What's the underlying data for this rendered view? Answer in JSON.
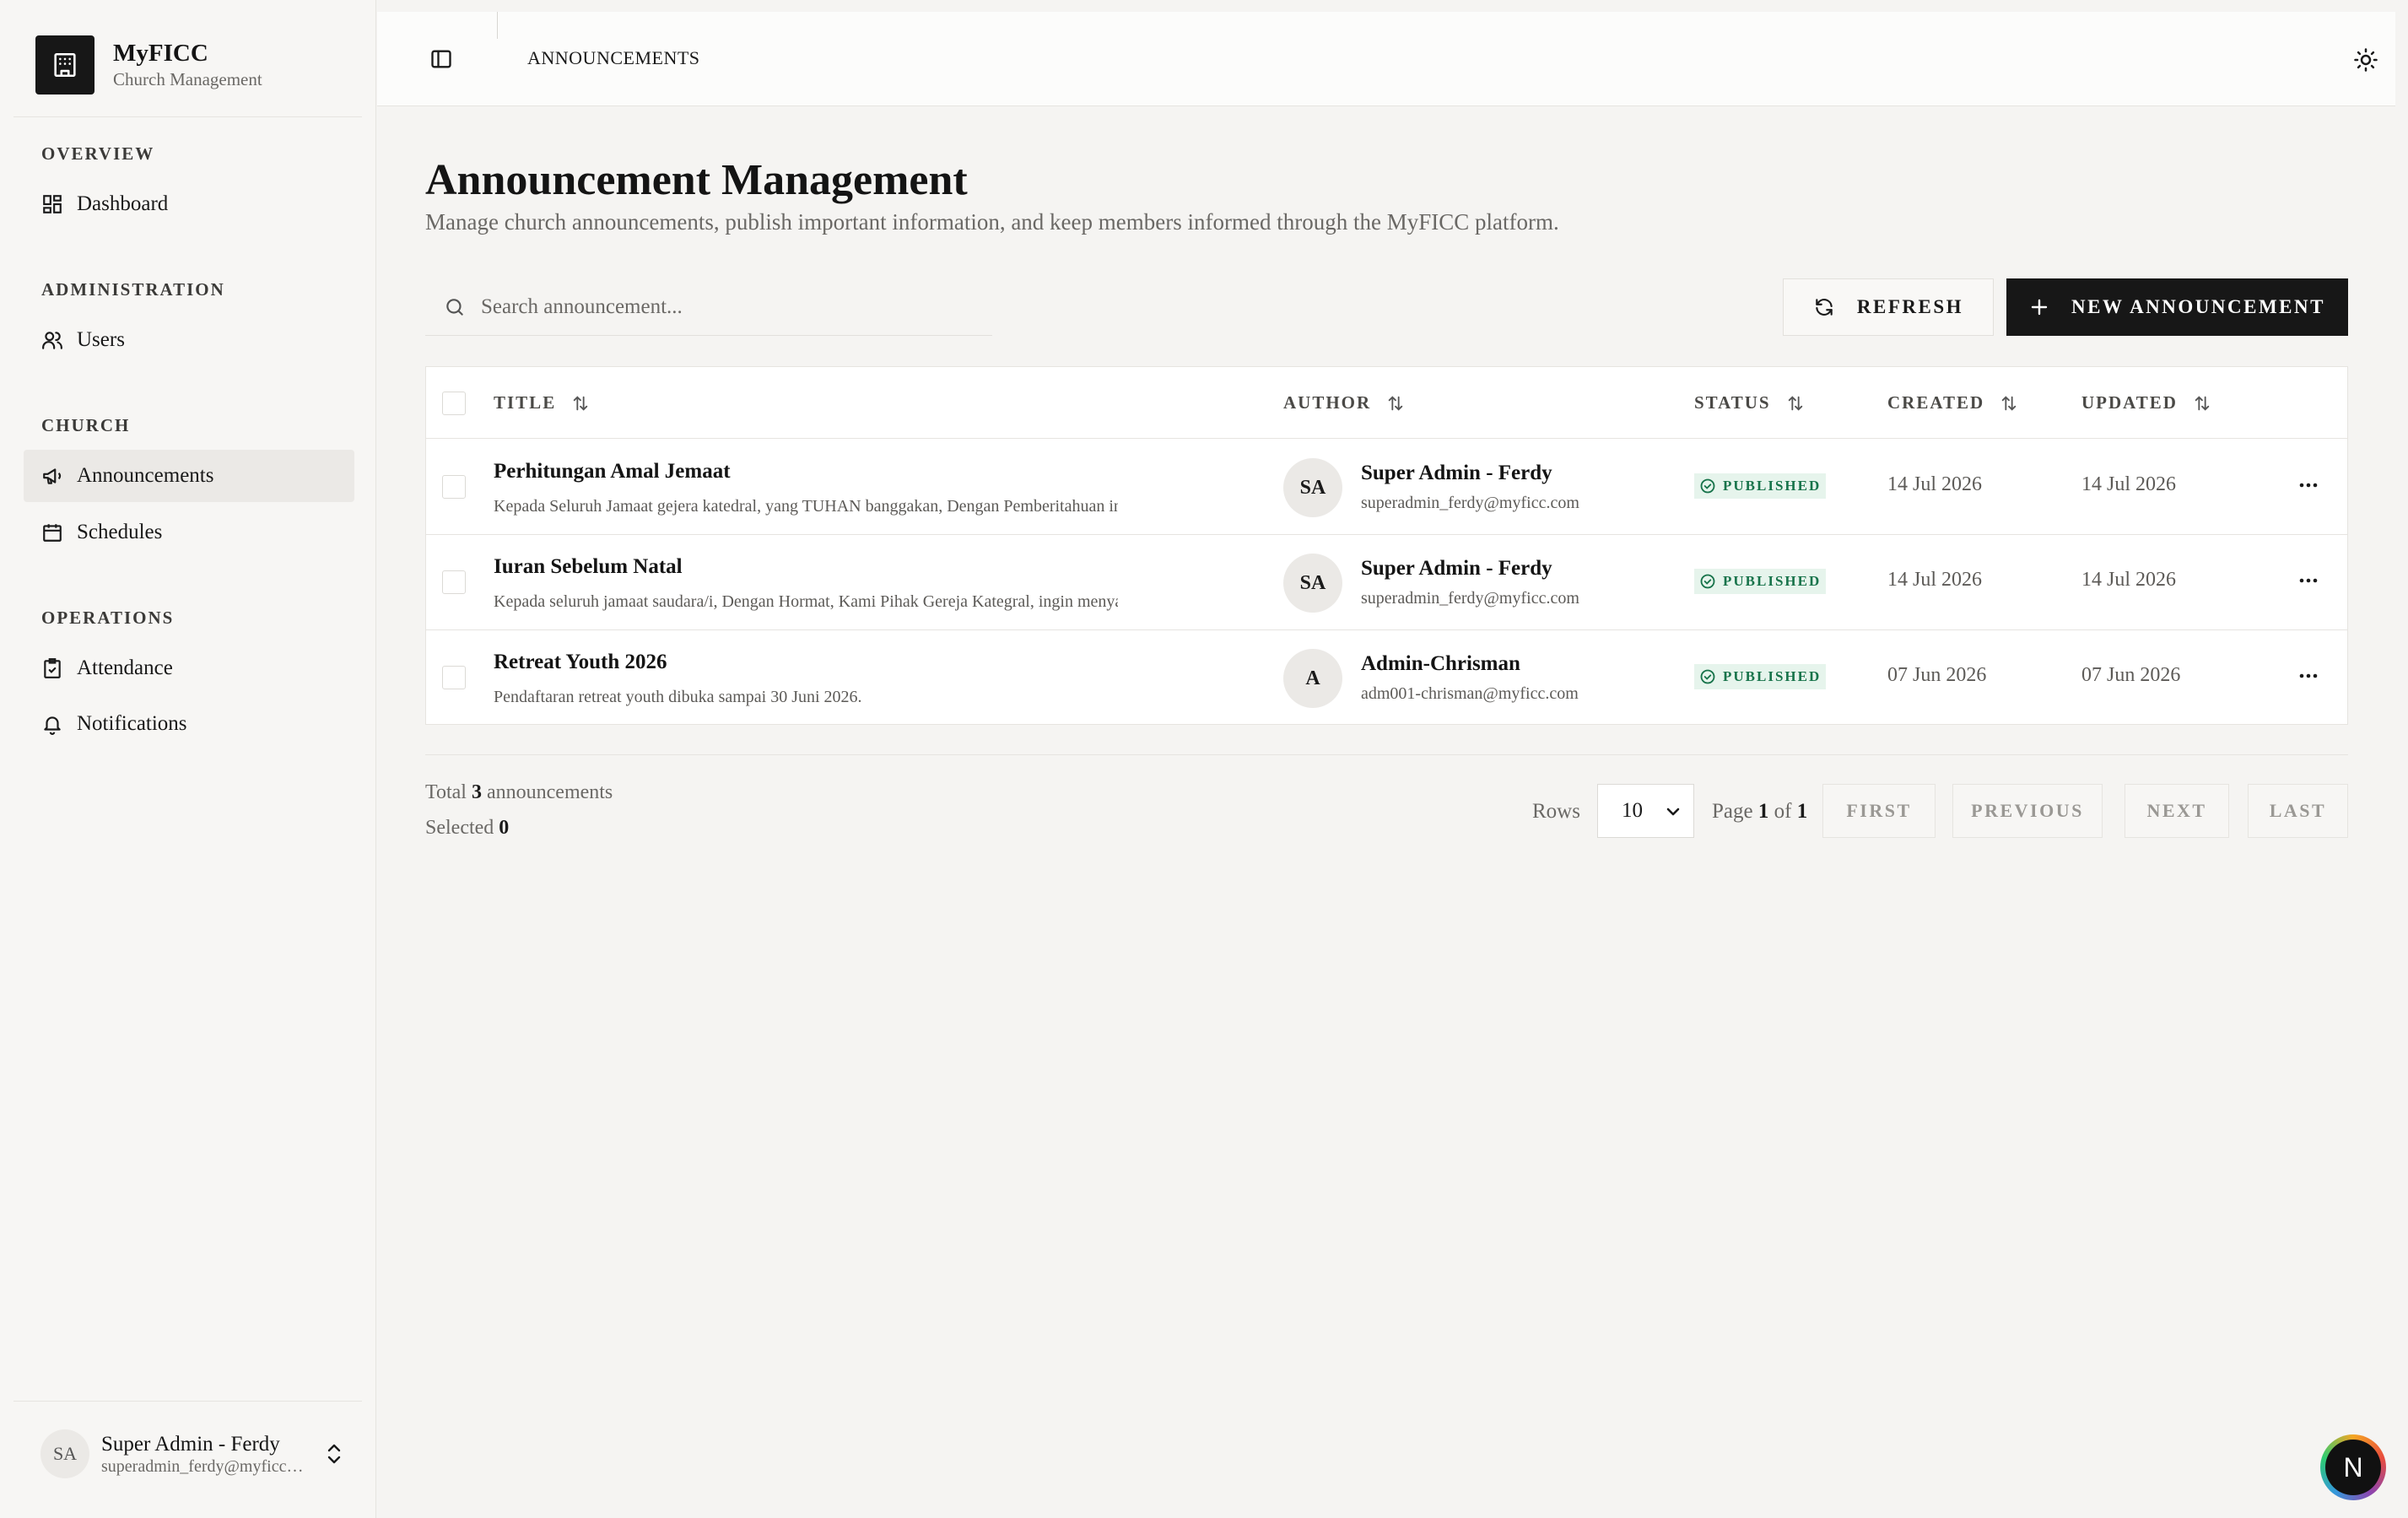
{
  "brand": {
    "name": "MyFICC",
    "subtitle": "Church Management"
  },
  "sidebar": {
    "sections": [
      {
        "label": "OVERVIEW",
        "items": [
          {
            "label": "Dashboard",
            "icon": "dashboard-icon"
          }
        ]
      },
      {
        "label": "ADMINISTRATION",
        "items": [
          {
            "label": "Users",
            "icon": "users-icon"
          }
        ]
      },
      {
        "label": "CHURCH",
        "items": [
          {
            "label": "Announcements",
            "icon": "megaphone-icon",
            "active": true
          },
          {
            "label": "Schedules",
            "icon": "calendar-icon"
          }
        ]
      },
      {
        "label": "OPERATIONS",
        "items": [
          {
            "label": "Attendance",
            "icon": "clipboard-check-icon"
          },
          {
            "label": "Notifications",
            "icon": "bell-icon"
          }
        ]
      }
    ],
    "user": {
      "initials": "SA",
      "name": "Super Admin - Ferdy",
      "email": "superadmin_ferdy@myficc.com"
    }
  },
  "topbar": {
    "breadcrumb": "ANNOUNCEMENTS"
  },
  "page": {
    "title": "Announcement Management",
    "subtitle": "Manage church announcements, publish important information, and keep members informed through the MyFICC platform."
  },
  "toolbar": {
    "search_placeholder": "Search announcement...",
    "refresh_label": "REFRESH",
    "new_label": "NEW ANNOUNCEMENT"
  },
  "table": {
    "columns": [
      "TITLE",
      "AUTHOR",
      "STATUS",
      "CREATED",
      "UPDATED"
    ],
    "rows": [
      {
        "title": "Perhitungan Amal Jemaat",
        "description": "Kepada Seluruh Jamaat gejera katedral, yang TUHAN banggakan, Dengan Pemberitahuan ini kami sampaikan",
        "author_initials": "SA",
        "author_name": "Super Admin - Ferdy",
        "author_email": "superadmin_ferdy@myficc.com",
        "status": "PUBLISHED",
        "created": "14 Jul 2026",
        "updated": "14 Jul 2026"
      },
      {
        "title": "Iuran Sebelum Natal",
        "description": "Kepada seluruh jamaat saudara/i, Dengan Hormat, Kami Pihak Gereja Kategral, ingin menyampaikan",
        "author_initials": "SA",
        "author_name": "Super Admin - Ferdy",
        "author_email": "superadmin_ferdy@myficc.com",
        "status": "PUBLISHED",
        "created": "14 Jul 2026",
        "updated": "14 Jul 2026"
      },
      {
        "title": "Retreat Youth 2026",
        "description": "Pendaftaran retreat youth dibuka sampai 30 Juni 2026.",
        "author_initials": "A",
        "author_name": "Admin-Chrisman",
        "author_email": "adm001-chrisman@myficc.com",
        "status": "PUBLISHED",
        "created": "07 Jun 2026",
        "updated": "07 Jun 2026"
      }
    ]
  },
  "footer": {
    "total_prefix": "Total",
    "total_count": "3",
    "total_suffix": "announcements",
    "selected_prefix": "Selected",
    "selected_count": "0",
    "rows_label": "Rows",
    "rows_value": "10",
    "page_prefix": "Page",
    "page_current": "1",
    "page_of": "of",
    "page_total": "1",
    "first": "FIRST",
    "previous": "PREVIOUS",
    "next": "NEXT",
    "last": "LAST"
  },
  "fab": {
    "label": "N"
  },
  "colors": {
    "primary": "#171717",
    "published_bg": "#e6f4ec",
    "published_fg": "#17734a",
    "background": "#f5f4f2"
  }
}
